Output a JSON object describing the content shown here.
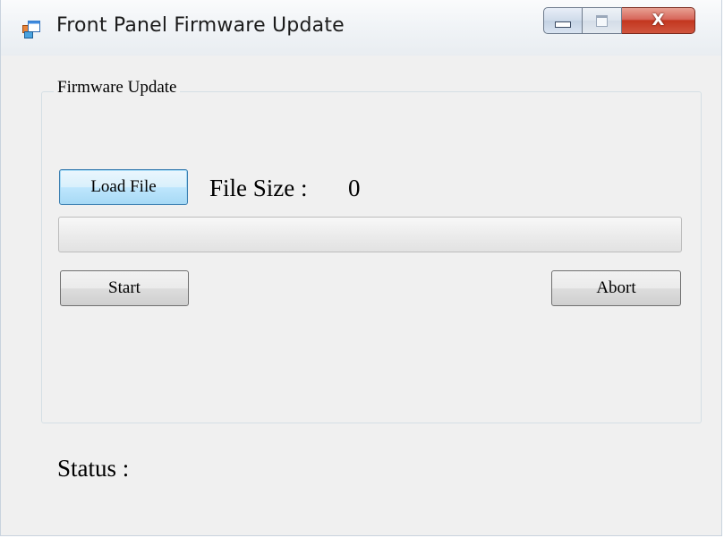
{
  "window": {
    "title": "Front Panel Firmware Update",
    "app_icon": "form-app-icon",
    "caption_icons": {
      "minimize": "minimize-icon",
      "maximize": "maximize-icon",
      "close": "close-icon"
    },
    "close_glyph": "X"
  },
  "firmware_update": {
    "group_label": "Firmware Update",
    "load_file_label": "Load File",
    "file_size_label": "File Size :",
    "file_size_value": "0",
    "progress_fraction": 0,
    "start_label": "Start",
    "abort_label": "Abort"
  },
  "status": {
    "label": "Status :"
  },
  "colors": {
    "window_bg": "#f0f0f0",
    "close_button": "#c2361f",
    "focus_border": "#3c7fb1",
    "progress_fill": "#06b025"
  }
}
